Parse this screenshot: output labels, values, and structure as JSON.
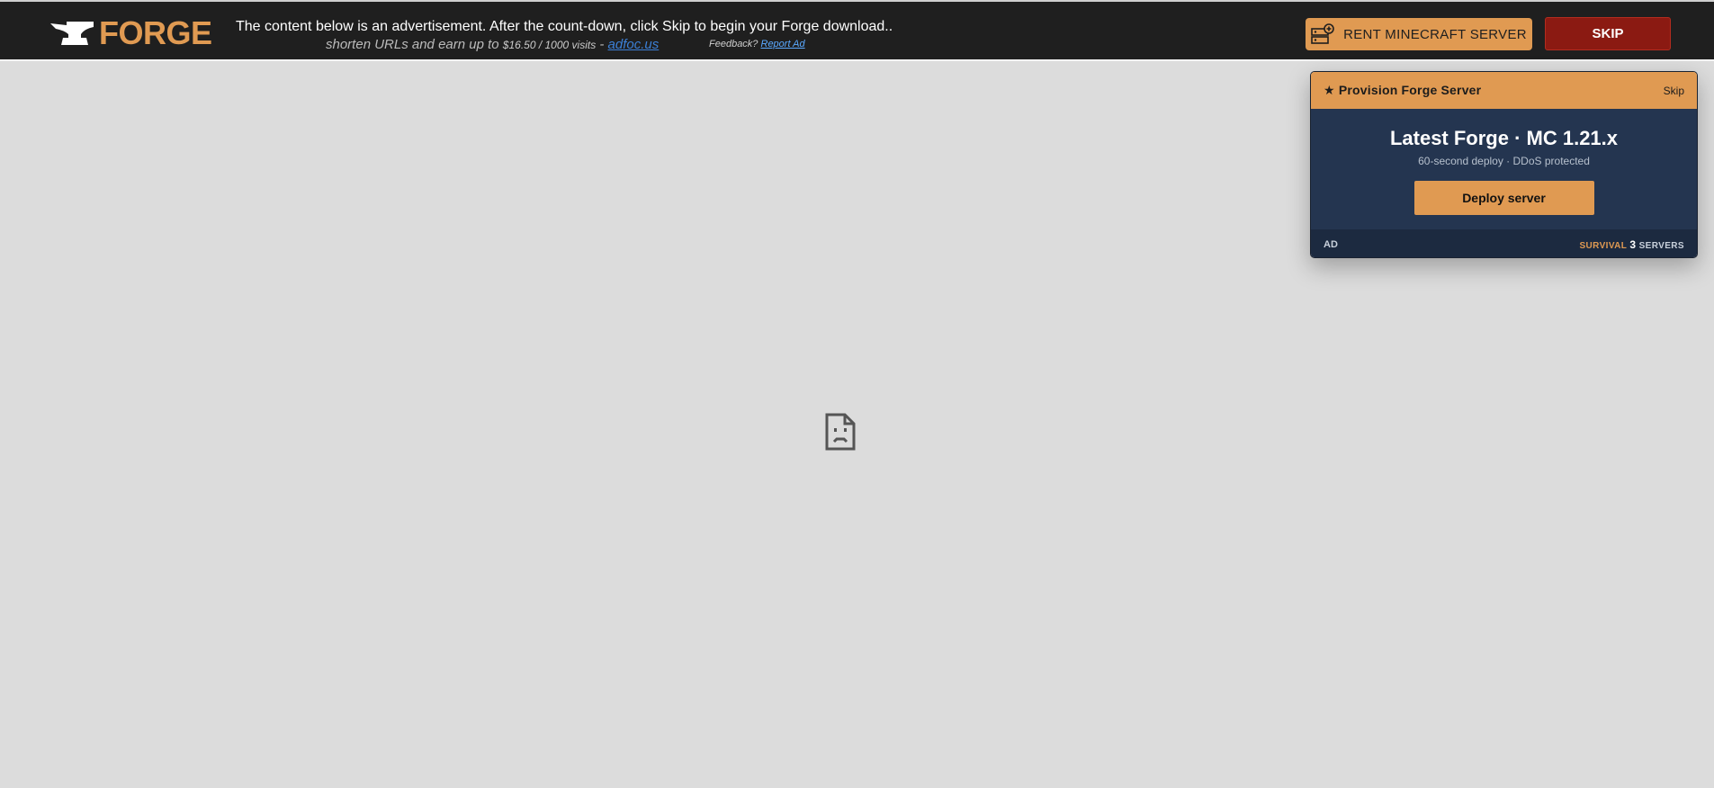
{
  "header": {
    "logo_text": "FORGE",
    "notice": "The content below is an advertisement. After the count-down, click Skip to begin your Forge download..",
    "subline_prefix": "shorten URLs and earn up to",
    "subline_rate": "$16.50 / 1000 visits",
    "subline_sep": "-",
    "subline_link": "adfoc.us",
    "feedback_label": "Feedback?",
    "feedback_link": "Report Ad",
    "rent_button": "RENT MINECRAFT SERVER",
    "skip_button": "SKIP"
  },
  "ad": {
    "header_star": "★",
    "header_title": "Provision Forge Server",
    "header_skip": "Skip",
    "title": "Latest Forge · MC 1.21.x",
    "subtitle": "60-second deploy · DDoS protected",
    "cta": "Deploy server",
    "badge": "AD",
    "brand_left": "SURVIVAL",
    "brand_mark": "3",
    "brand_right": "SERVERS"
  },
  "colors": {
    "accent": "#e09a52",
    "topbar": "#1f1f1f",
    "skip": "#8b1a12",
    "ad_body": "#243550",
    "page_bg": "#dcdcdc"
  },
  "icons": {
    "logo": "anvil-icon",
    "rent": "server-add-icon",
    "content": "broken-page-icon"
  }
}
